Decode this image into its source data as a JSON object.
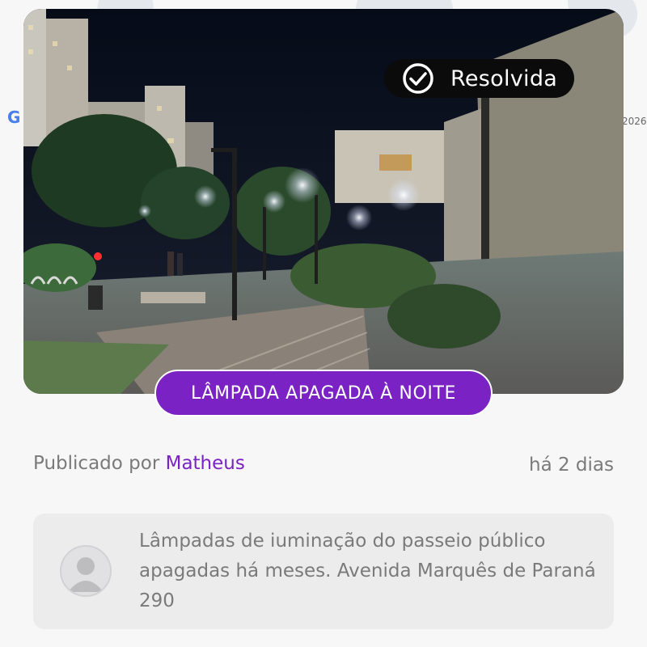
{
  "photo": {
    "description_icon": "street-photo",
    "status": {
      "label": "Resolvida",
      "icon": "check-circle-icon"
    }
  },
  "category": {
    "label": "LÂMPADA APAGADA À NOITE",
    "color": "#7b22c4"
  },
  "post": {
    "published_prefix": "Publicado por ",
    "author": "Matheus",
    "time_ago": "há 2 dias"
  },
  "comment": {
    "avatar_icon": "user-avatar-icon",
    "text": "Lâmpadas de iuminação do passeio público apagadas há meses. Avenida Marquês de Paraná 290"
  },
  "map_remnants": {
    "glyph": "G",
    "year": "2026"
  }
}
